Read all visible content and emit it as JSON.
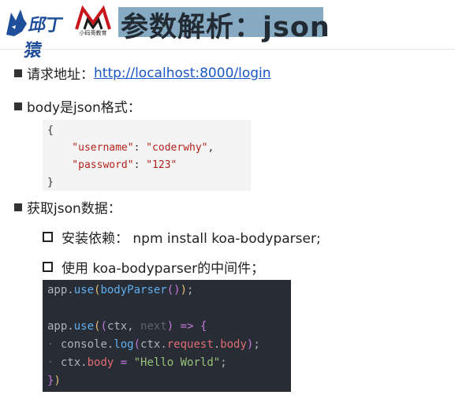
{
  "header": {
    "logo_left_text": "邱丁猿",
    "logo_right_sub": "小码哥教育",
    "title": "参数解析：json"
  },
  "bullets": {
    "b1_label": "请求地址：",
    "b1_link": "http://localhost:8000/login",
    "b2_label": "body是json格式：",
    "b3_label": "获取json数据：",
    "sub1": "安装依赖： npm install koa-bodyparser;",
    "sub2": "使用 koa-bodyparser的中间件；"
  },
  "json_lines": [
    "{",
    "    \"username\": \"coderwhy\",",
    "    \"password\": \"123\"",
    "}"
  ],
  "code_lines": [
    "app.use(bodyParser());",
    "",
    "app.use((ctx, next) => {",
    "  console.log(ctx.request.body);",
    "  ctx.body = \"Hello World\";",
    "})"
  ],
  "colors": {
    "title_bg": "#86aac2",
    "link": "#1a56c6",
    "code_bg": "#282c34",
    "json_bg": "#f4f4f4"
  }
}
